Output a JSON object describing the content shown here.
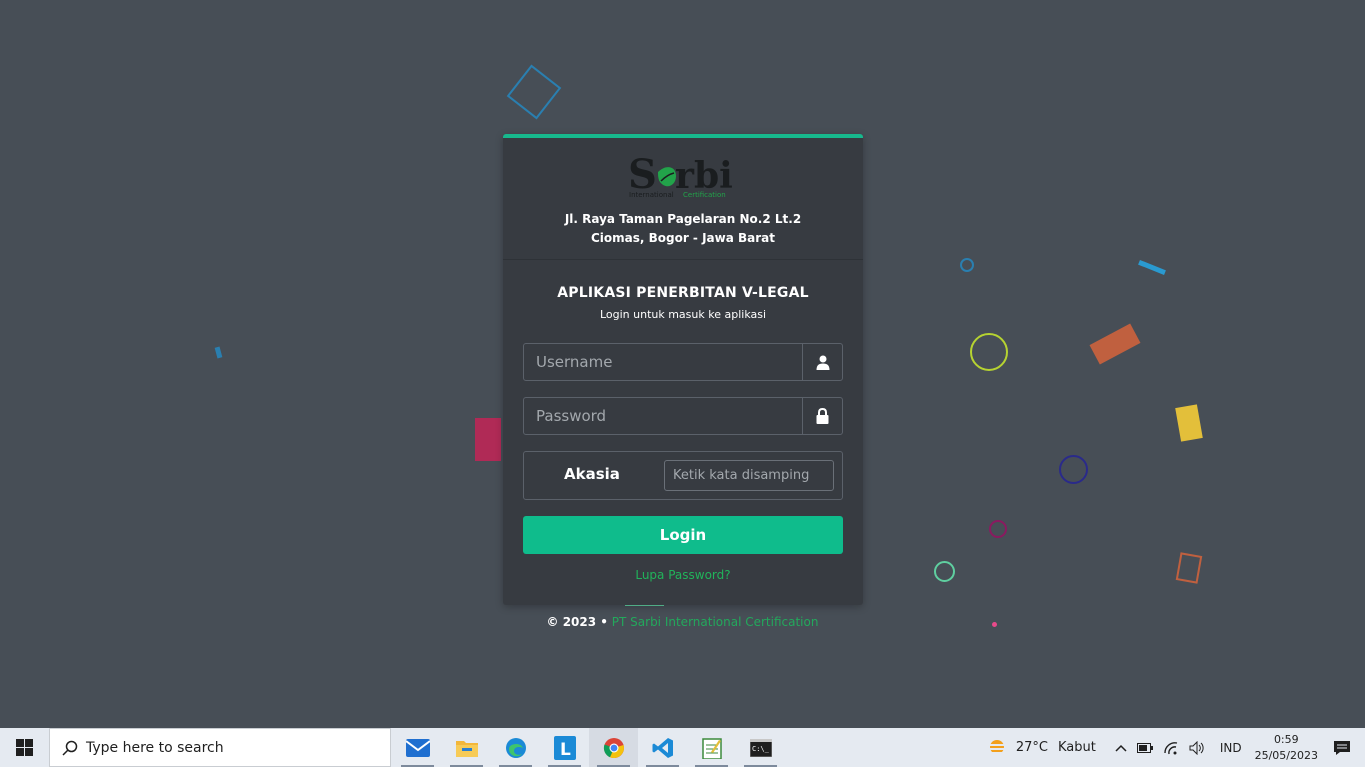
{
  "app": {
    "address_line1": "Jl. Raya Taman Pagelaran No.2 Lt.2",
    "address_line2": "Ciomas, Bogor - Jawa Barat",
    "title": "APLIKASI PENERBITAN V-LEGAL",
    "subtitle": "Login untuk masuk ke aplikasi",
    "logo_text": "Sarbi",
    "logo_sub_1": "International",
    "logo_sub_2": "Certification",
    "accent_color": "#0fbc8c"
  },
  "form": {
    "username_placeholder": "Username",
    "password_placeholder": "Password",
    "captcha_word": "Akasia",
    "captcha_placeholder": "Ketik kata disamping",
    "login_label": "Login",
    "forgot_label": "Lupa Password?"
  },
  "footer": {
    "copyright": "© 2023 •",
    "company": "PT Sarbi International Certification"
  },
  "taskbar": {
    "search_placeholder": "Type here to search",
    "apps": [
      "mail-icon",
      "file-explorer-icon",
      "edge-icon",
      "l-app-icon",
      "chrome-icon",
      "vscode-icon",
      "notepad-icon",
      "terminal-icon"
    ],
    "weather_temp": "27°C",
    "weather_desc": "Kabut",
    "language": "IND",
    "time": "0:59",
    "date": "25/05/2023"
  }
}
